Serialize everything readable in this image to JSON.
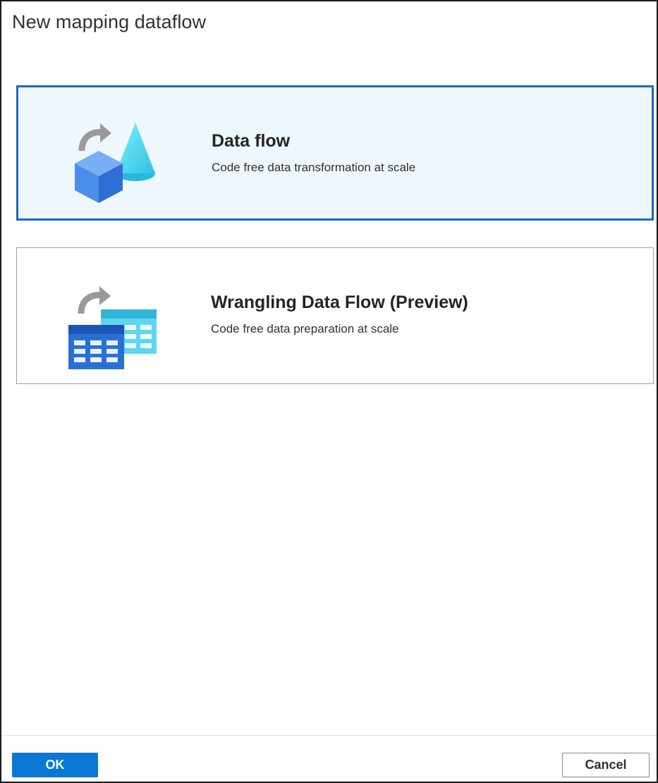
{
  "dialog": {
    "title": "New mapping dataflow"
  },
  "options": [
    {
      "title": "Data flow",
      "description": "Code free data transformation at scale",
      "icon": "data-flow-icon",
      "selected": true
    },
    {
      "title": "Wrangling Data Flow (Preview)",
      "description": "Code free data preparation at scale",
      "icon": "wrangling-data-flow-icon",
      "selected": false
    }
  ],
  "footer": {
    "ok_label": "OK",
    "cancel_label": "Cancel"
  },
  "colors": {
    "accent": "#0a78d4",
    "selected_border": "#1d67c4",
    "selected_background": "#eef6fe"
  }
}
